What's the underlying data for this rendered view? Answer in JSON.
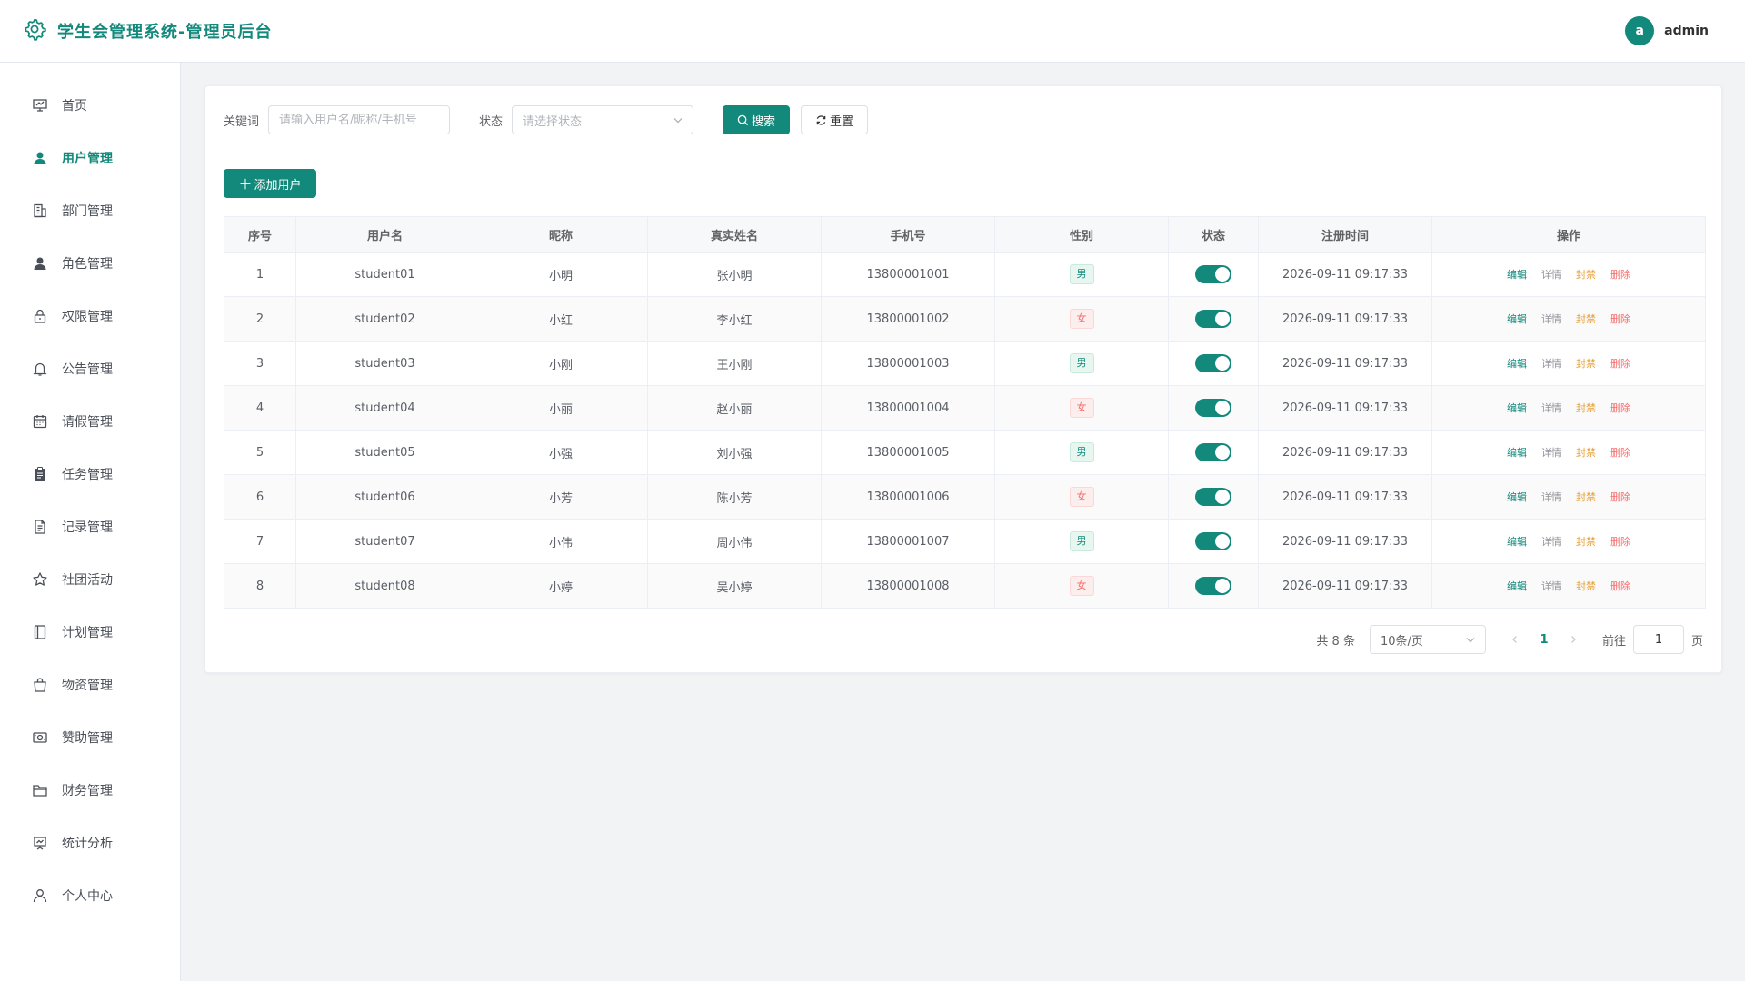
{
  "header": {
    "title": "学生会管理系统-管理员后台",
    "user": {
      "avatar_letter": "a",
      "name": "admin"
    }
  },
  "colors": {
    "accent": "#13897c",
    "danger": "#f56c6c",
    "warning": "#e6a23c"
  },
  "sidebar": {
    "items": [
      {
        "label": "首页",
        "icon": "dashboard-icon",
        "active": false
      },
      {
        "label": "用户管理",
        "icon": "user-icon",
        "active": true
      },
      {
        "label": "部门管理",
        "icon": "building-icon",
        "active": false
      },
      {
        "label": "角色管理",
        "icon": "role-icon",
        "active": false
      },
      {
        "label": "权限管理",
        "icon": "lock-icon",
        "active": false
      },
      {
        "label": "公告管理",
        "icon": "bell-icon",
        "active": false
      },
      {
        "label": "请假管理",
        "icon": "calendar-icon",
        "active": false
      },
      {
        "label": "任务管理",
        "icon": "clipboard-icon",
        "active": false
      },
      {
        "label": "记录管理",
        "icon": "document-icon",
        "active": false
      },
      {
        "label": "社团活动",
        "icon": "star-icon",
        "active": false
      },
      {
        "label": "计划管理",
        "icon": "notebook-icon",
        "active": false
      },
      {
        "label": "物资管理",
        "icon": "bag-icon",
        "active": false
      },
      {
        "label": "赞助管理",
        "icon": "money-icon",
        "active": false
      },
      {
        "label": "财务管理",
        "icon": "folder-icon",
        "active": false
      },
      {
        "label": "统计分析",
        "icon": "presentation-icon",
        "active": false
      },
      {
        "label": "个人中心",
        "icon": "person-icon",
        "active": false
      }
    ]
  },
  "search": {
    "keyword_label": "关键词",
    "keyword_placeholder": "请输入用户名/昵称/手机号",
    "status_label": "状态",
    "status_placeholder": "请选择状态",
    "search_button": "搜索",
    "reset_button": "重置"
  },
  "toolbar": {
    "add_button": "添加用户"
  },
  "table": {
    "columns": [
      "序号",
      "用户名",
      "昵称",
      "真实姓名",
      "手机号",
      "性别",
      "状态",
      "注册时间",
      "操作"
    ],
    "actions": {
      "edit": "编辑",
      "detail": "详情",
      "ban": "封禁",
      "delete": "删除"
    },
    "rows": [
      {
        "index": "1",
        "username": "student01",
        "nickname": "小明",
        "realname": "张小明",
        "phone": "13800001001",
        "gender": "男",
        "enabled": true,
        "registered": "2026-09-11 09:17:33"
      },
      {
        "index": "2",
        "username": "student02",
        "nickname": "小红",
        "realname": "李小红",
        "phone": "13800001002",
        "gender": "女",
        "enabled": true,
        "registered": "2026-09-11 09:17:33"
      },
      {
        "index": "3",
        "username": "student03",
        "nickname": "小刚",
        "realname": "王小刚",
        "phone": "13800001003",
        "gender": "男",
        "enabled": true,
        "registered": "2026-09-11 09:17:33"
      },
      {
        "index": "4",
        "username": "student04",
        "nickname": "小丽",
        "realname": "赵小丽",
        "phone": "13800001004",
        "gender": "女",
        "enabled": true,
        "registered": "2026-09-11 09:17:33"
      },
      {
        "index": "5",
        "username": "student05",
        "nickname": "小强",
        "realname": "刘小强",
        "phone": "13800001005",
        "gender": "男",
        "enabled": true,
        "registered": "2026-09-11 09:17:33"
      },
      {
        "index": "6",
        "username": "student06",
        "nickname": "小芳",
        "realname": "陈小芳",
        "phone": "13800001006",
        "gender": "女",
        "enabled": true,
        "registered": "2026-09-11 09:17:33"
      },
      {
        "index": "7",
        "username": "student07",
        "nickname": "小伟",
        "realname": "周小伟",
        "phone": "13800001007",
        "gender": "男",
        "enabled": true,
        "registered": "2026-09-11 09:17:33"
      },
      {
        "index": "8",
        "username": "student08",
        "nickname": "小婷",
        "realname": "吴小婷",
        "phone": "13800001008",
        "gender": "女",
        "enabled": true,
        "registered": "2026-09-11 09:17:33"
      }
    ]
  },
  "pagination": {
    "total_text": "共 8 条",
    "page_size": "10条/页",
    "current_page": "1",
    "goto_label": "前往",
    "goto_value": "1",
    "page_suffix": "页"
  }
}
